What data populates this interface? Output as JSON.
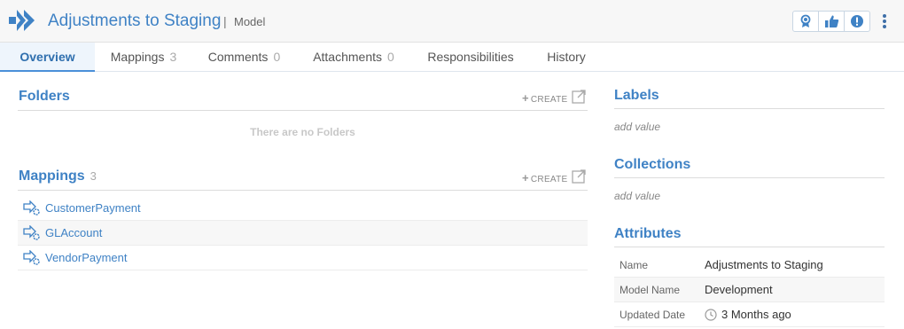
{
  "header": {
    "title": "Adjustments to Staging",
    "separator": "|",
    "object_type": "Model",
    "actions": [
      "certify-icon",
      "endorse-icon",
      "warning-icon"
    ],
    "brand_color": "#3f82c5"
  },
  "tabs": [
    {
      "label": "Overview",
      "count": ""
    },
    {
      "label": "Mappings",
      "count": "3"
    },
    {
      "label": "Comments",
      "count": "0"
    },
    {
      "label": "Attachments",
      "count": "0"
    },
    {
      "label": "Responsibilities",
      "count": ""
    },
    {
      "label": "History",
      "count": ""
    }
  ],
  "folders": {
    "title": "Folders",
    "create_label": "CREATE",
    "empty_text": "There are no Folders"
  },
  "mappings": {
    "title": "Mappings",
    "count": "3",
    "create_label": "CREATE",
    "items": [
      "CustomerPayment",
      "GLAccount",
      "VendorPayment"
    ]
  },
  "labels": {
    "title": "Labels",
    "placeholder": "add value"
  },
  "collections": {
    "title": "Collections",
    "placeholder": "add value"
  },
  "attributes": {
    "title": "Attributes",
    "rows": [
      {
        "key": "Name",
        "value": "Adjustments to Staging"
      },
      {
        "key": "Model Name",
        "value": "Development"
      },
      {
        "key": "Updated Date",
        "value": "3 Months ago"
      }
    ]
  }
}
